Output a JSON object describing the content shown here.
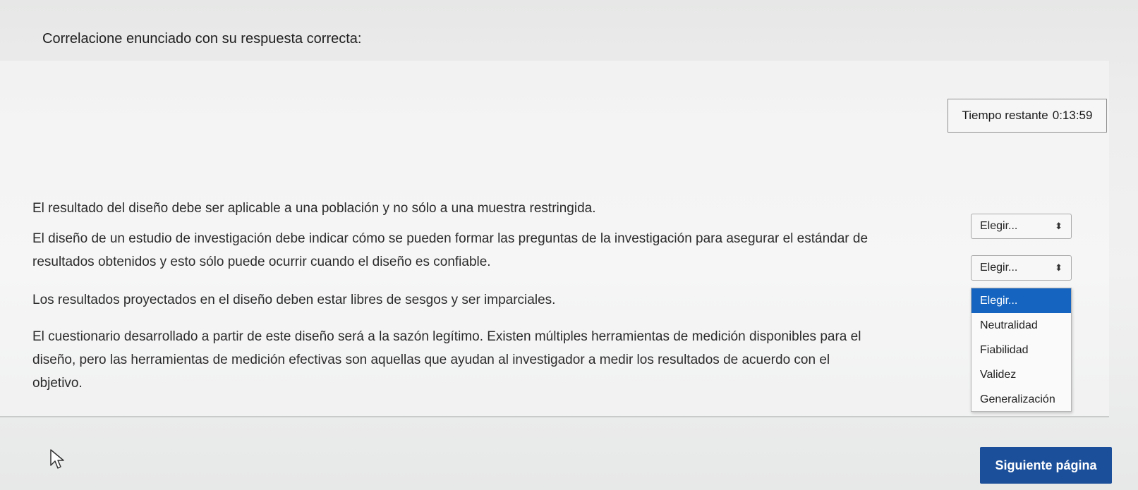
{
  "quiz": {
    "instruction": "Correlacione enunciado con su respuesta correcta:",
    "timer_label": "Tiempo restante",
    "timer_value": "0:13:59",
    "statements": [
      {
        "lines": [
          "El resultado del diseño debe ser aplicable a una población y no sólo a una muestra restringida."
        ]
      },
      {
        "lines": [
          "El diseño de un estudio de investigación debe indicar cómo se pueden formar las preguntas de la investigación para asegurar el estándar de",
          "resultados obtenidos y esto sólo puede ocurrir cuando el diseño es confiable."
        ]
      },
      {
        "lines": [
          "Los resultados proyectados en el diseño deben estar libres de sesgos y ser imparciales."
        ]
      },
      {
        "lines": [
          "El cuestionario desarrollado a partir de este diseño será a la sazón legítimo. Existen múltiples herramientas de medición disponibles para el",
          "diseño, pero las herramientas de medición efectivas son aquellas que ayudan al investigador a medir los resultados de acuerdo con el",
          "objetivo."
        ]
      }
    ],
    "selects": [
      {
        "value": "Elegir..."
      },
      {
        "value": "Elegir..."
      }
    ],
    "dropdown_options": [
      "Elegir...",
      "Neutralidad",
      "Fiabilidad",
      "Validez",
      "Generalización"
    ],
    "dropdown_highlighted": "Elegir...",
    "select_arrow": "⬍",
    "next_button": "Siguiente página",
    "accent_color": "#1b4f9a",
    "highlight_color": "#1565c0"
  }
}
